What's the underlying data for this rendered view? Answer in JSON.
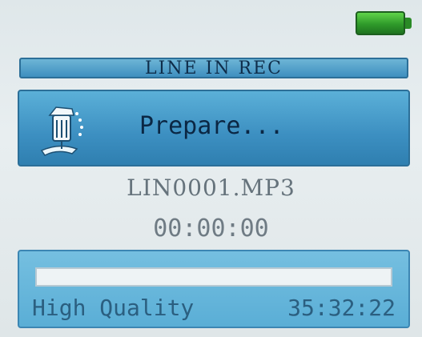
{
  "header": {
    "battery_icon": "battery-full-icon",
    "battery_color": "#3fbf36"
  },
  "title": "LINE IN REC",
  "status": {
    "icon": "line-in-recorder-icon",
    "text": "Prepare..."
  },
  "recording": {
    "file_name": "LIN0001.MP3",
    "elapsed": "00:00:00",
    "progress": 0
  },
  "footer": {
    "quality": "High Quality",
    "remaining_time": "35:32:22"
  },
  "colors": {
    "panel": "#3f8fbf",
    "title_bar": "#4f9fca",
    "screen_bg": "#e3eaed"
  }
}
